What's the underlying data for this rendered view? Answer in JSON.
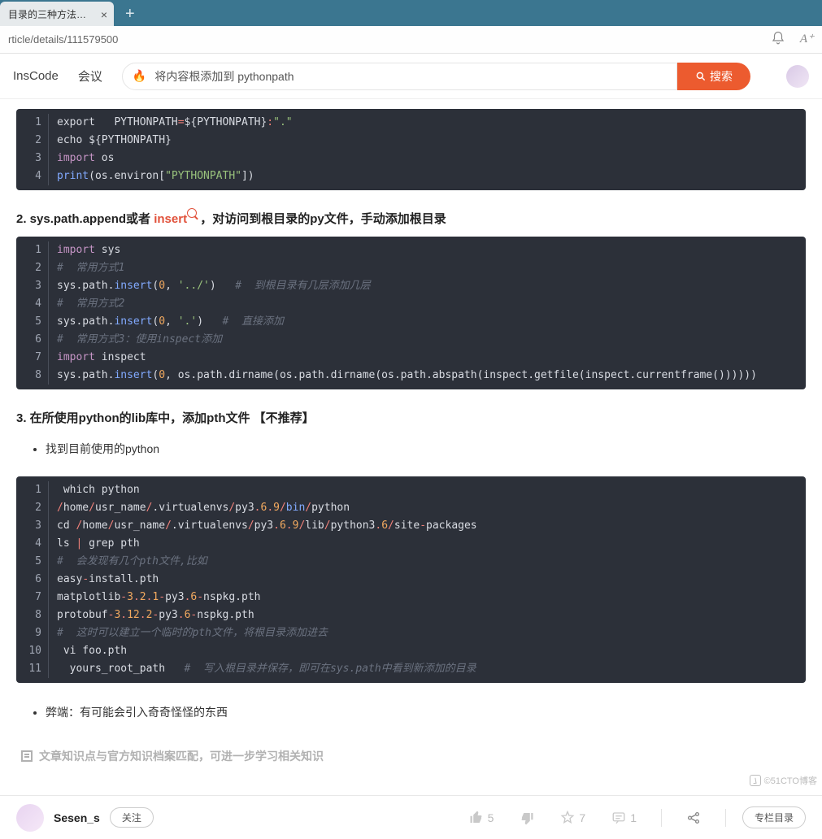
{
  "tab": {
    "title": "目录的三种方法_余"
  },
  "url": "rticle/details/111579500",
  "nav": {
    "link_inscode": "InsCode",
    "link_meeting": "会议",
    "search_value": "将内容根添加到 pythonpath",
    "search_btn": "搜索"
  },
  "code1": {
    "lines": [
      {
        "n": "1",
        "segs": [
          {
            "t": "plain",
            "v": "export   PYTHONPATH"
          },
          {
            "t": "op",
            "v": "="
          },
          {
            "t": "plain",
            "v": "${PYTHONPATH}"
          },
          {
            "t": "op",
            "v": ":"
          },
          {
            "t": "str",
            "v": "\".\""
          }
        ]
      },
      {
        "n": "2",
        "segs": [
          {
            "t": "plain",
            "v": "echo ${PYTHONPATH}"
          }
        ]
      },
      {
        "n": "3",
        "segs": [
          {
            "t": "kw",
            "v": "import"
          },
          {
            "t": "plain",
            "v": " os"
          }
        ]
      },
      {
        "n": "4",
        "segs": [
          {
            "t": "fn",
            "v": "print"
          },
          {
            "t": "plain",
            "v": "(os.environ["
          },
          {
            "t": "str",
            "v": "\"PYTHONPATH\""
          },
          {
            "t": "plain",
            "v": "])"
          }
        ]
      }
    ]
  },
  "h2": {
    "prefix": "2. sys.path.append或者 ",
    "insert": "insert",
    "suffix": " ，对访问到根目录的py文件，手动添加根目录"
  },
  "code2": {
    "lines": [
      {
        "n": "1",
        "segs": [
          {
            "t": "kw",
            "v": "import"
          },
          {
            "t": "plain",
            "v": " sys"
          }
        ]
      },
      {
        "n": "2",
        "segs": [
          {
            "t": "cmt",
            "v": "#  常用方式1"
          }
        ]
      },
      {
        "n": "3",
        "segs": [
          {
            "t": "plain",
            "v": "sys.path."
          },
          {
            "t": "fn",
            "v": "insert"
          },
          {
            "t": "plain",
            "v": "("
          },
          {
            "t": "num",
            "v": "0"
          },
          {
            "t": "plain",
            "v": ", "
          },
          {
            "t": "str",
            "v": "'../'"
          },
          {
            "t": "plain",
            "v": ")   "
          },
          {
            "t": "cmt",
            "v": "#  到根目录有几层添加几层"
          }
        ]
      },
      {
        "n": "4",
        "segs": [
          {
            "t": "cmt",
            "v": "#  常用方式2"
          }
        ]
      },
      {
        "n": "5",
        "segs": [
          {
            "t": "plain",
            "v": "sys.path."
          },
          {
            "t": "fn",
            "v": "insert"
          },
          {
            "t": "plain",
            "v": "("
          },
          {
            "t": "num",
            "v": "0"
          },
          {
            "t": "plain",
            "v": ", "
          },
          {
            "t": "str",
            "v": "'.'"
          },
          {
            "t": "plain",
            "v": ")   "
          },
          {
            "t": "cmt",
            "v": "#  直接添加"
          }
        ]
      },
      {
        "n": "6",
        "segs": [
          {
            "t": "cmt",
            "v": "#  常用方式3：使用inspect添加"
          }
        ]
      },
      {
        "n": "7",
        "segs": [
          {
            "t": "kw",
            "v": "import"
          },
          {
            "t": "plain",
            "v": " inspect"
          }
        ]
      },
      {
        "n": "8",
        "segs": [
          {
            "t": "plain",
            "v": "sys.path."
          },
          {
            "t": "fn",
            "v": "insert"
          },
          {
            "t": "plain",
            "v": "("
          },
          {
            "t": "num",
            "v": "0"
          },
          {
            "t": "plain",
            "v": ", os.path.dirname(os.path.dirname(os.path.abspath(inspect.getfile(inspect.currentframe())))))"
          }
        ]
      }
    ]
  },
  "h3": "3. 在所使用python的lib库中，添加pth文件 【不推荐】",
  "bullet1": "找到目前使用的python",
  "code3": {
    "lines": [
      {
        "n": "1",
        "segs": [
          {
            "t": "plain",
            "v": " which python"
          }
        ]
      },
      {
        "n": "2",
        "segs": [
          {
            "t": "op",
            "v": "/"
          },
          {
            "t": "plain",
            "v": "home"
          },
          {
            "t": "op",
            "v": "/"
          },
          {
            "t": "plain",
            "v": "usr_name"
          },
          {
            "t": "op",
            "v": "/"
          },
          {
            "t": "plain",
            "v": ".virtualenvs"
          },
          {
            "t": "op",
            "v": "/"
          },
          {
            "t": "plain",
            "v": "py3"
          },
          {
            "t": "op",
            "v": "."
          },
          {
            "t": "num",
            "v": "6"
          },
          {
            "t": "op",
            "v": "."
          },
          {
            "t": "num",
            "v": "9"
          },
          {
            "t": "op",
            "v": "/"
          },
          {
            "t": "fn",
            "v": "bin"
          },
          {
            "t": "op",
            "v": "/"
          },
          {
            "t": "plain",
            "v": "python"
          }
        ]
      },
      {
        "n": "3",
        "segs": [
          {
            "t": "plain",
            "v": "cd "
          },
          {
            "t": "op",
            "v": "/"
          },
          {
            "t": "plain",
            "v": "home"
          },
          {
            "t": "op",
            "v": "/"
          },
          {
            "t": "plain",
            "v": "usr_name"
          },
          {
            "t": "op",
            "v": "/"
          },
          {
            "t": "plain",
            "v": ".virtualenvs"
          },
          {
            "t": "op",
            "v": "/"
          },
          {
            "t": "plain",
            "v": "py3"
          },
          {
            "t": "op",
            "v": "."
          },
          {
            "t": "num",
            "v": "6"
          },
          {
            "t": "op",
            "v": "."
          },
          {
            "t": "num",
            "v": "9"
          },
          {
            "t": "op",
            "v": "/"
          },
          {
            "t": "plain",
            "v": "lib"
          },
          {
            "t": "op",
            "v": "/"
          },
          {
            "t": "plain",
            "v": "python3"
          },
          {
            "t": "op",
            "v": "."
          },
          {
            "t": "num",
            "v": "6"
          },
          {
            "t": "op",
            "v": "/"
          },
          {
            "t": "plain",
            "v": "site"
          },
          {
            "t": "op",
            "v": "-"
          },
          {
            "t": "plain",
            "v": "packages"
          }
        ]
      },
      {
        "n": "4",
        "segs": [
          {
            "t": "plain",
            "v": "ls "
          },
          {
            "t": "op",
            "v": "|"
          },
          {
            "t": "plain",
            "v": " grep pth"
          }
        ]
      },
      {
        "n": "5",
        "segs": [
          {
            "t": "cmt",
            "v": "#  会发现有几个pth文件,比如"
          }
        ]
      },
      {
        "n": "6",
        "segs": [
          {
            "t": "plain",
            "v": "easy"
          },
          {
            "t": "op",
            "v": "-"
          },
          {
            "t": "plain",
            "v": "install.pth"
          }
        ]
      },
      {
        "n": "7",
        "segs": [
          {
            "t": "plain",
            "v": "matplotlib"
          },
          {
            "t": "op",
            "v": "-"
          },
          {
            "t": "num",
            "v": "3"
          },
          {
            "t": "op",
            "v": "."
          },
          {
            "t": "num",
            "v": "2"
          },
          {
            "t": "op",
            "v": "."
          },
          {
            "t": "num",
            "v": "1"
          },
          {
            "t": "op",
            "v": "-"
          },
          {
            "t": "plain",
            "v": "py3"
          },
          {
            "t": "op",
            "v": "."
          },
          {
            "t": "num",
            "v": "6"
          },
          {
            "t": "op",
            "v": "-"
          },
          {
            "t": "plain",
            "v": "nspkg.pth"
          }
        ]
      },
      {
        "n": "8",
        "segs": [
          {
            "t": "plain",
            "v": "protobuf"
          },
          {
            "t": "op",
            "v": "-"
          },
          {
            "t": "num",
            "v": "3"
          },
          {
            "t": "op",
            "v": "."
          },
          {
            "t": "num",
            "v": "12"
          },
          {
            "t": "op",
            "v": "."
          },
          {
            "t": "num",
            "v": "2"
          },
          {
            "t": "op",
            "v": "-"
          },
          {
            "t": "plain",
            "v": "py3"
          },
          {
            "t": "op",
            "v": "."
          },
          {
            "t": "num",
            "v": "6"
          },
          {
            "t": "op",
            "v": "-"
          },
          {
            "t": "plain",
            "v": "nspkg.pth"
          }
        ]
      },
      {
        "n": "9",
        "segs": [
          {
            "t": "cmt",
            "v": "#  这时可以建立一个临时的pth文件，将根目录添加进去"
          }
        ]
      },
      {
        "n": "10",
        "segs": [
          {
            "t": "plain",
            "v": " vi foo.pth"
          }
        ]
      },
      {
        "n": "11",
        "segs": [
          {
            "t": "plain",
            "v": "  yours_root_path   "
          },
          {
            "t": "cmt",
            "v": "#  写入根目录并保存，即可在sys.path中看到新添加的目录"
          }
        ]
      }
    ]
  },
  "bullet2": "弊端：有可能会引入奇奇怪怪的东西",
  "faded": "文章知识点与官方知识档案匹配，可进一步学习相关知识",
  "bottom": {
    "author": "Sesen_s",
    "follow": "关注",
    "likes": "5",
    "stars": "7",
    "comments": "1",
    "col_btn": "专栏目录"
  },
  "watermark": "©51CTO博客"
}
